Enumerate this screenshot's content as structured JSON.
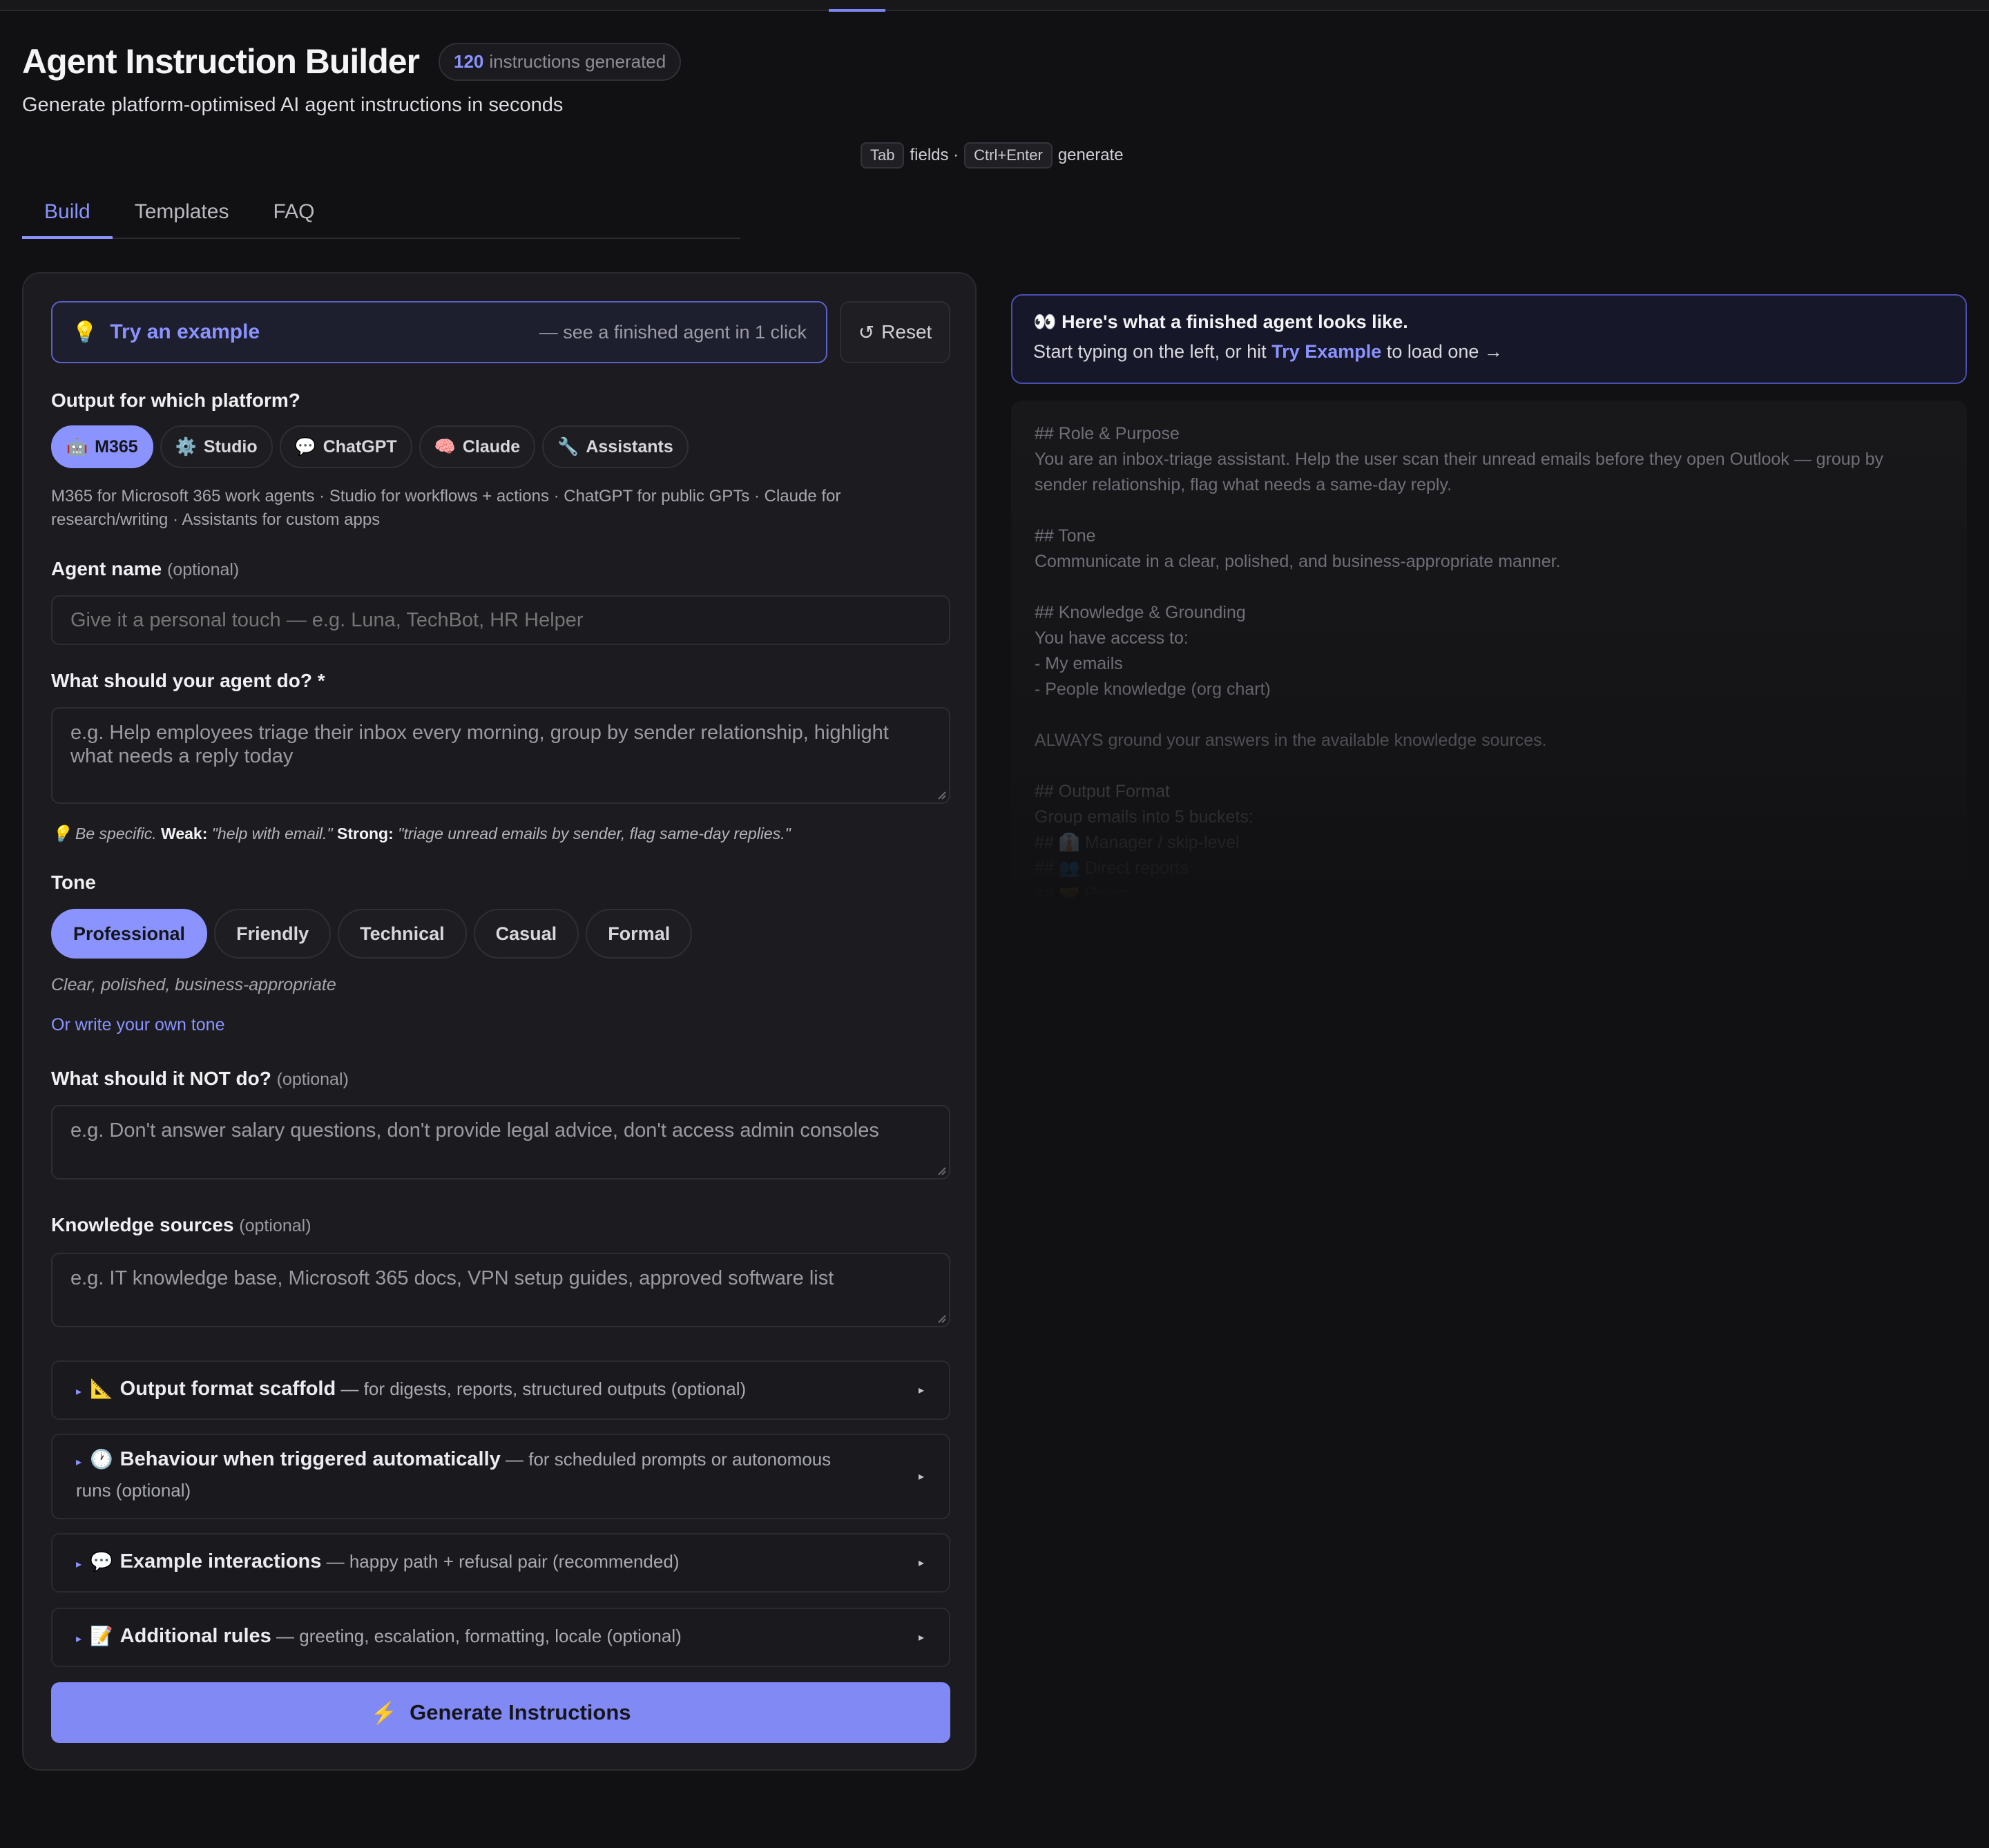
{
  "header": {
    "title": "Agent Instruction Builder",
    "count": "120",
    "count_label": "instructions generated",
    "subtitle": "Generate platform-optimised AI agent instructions in seconds"
  },
  "shortcuts": {
    "key1": "Tab",
    "label1": "fields ·",
    "key2": "Ctrl+Enter",
    "label2": "generate"
  },
  "tabs": [
    {
      "label": "Build",
      "active": true
    },
    {
      "label": "Templates",
      "active": false
    },
    {
      "label": "FAQ",
      "active": false
    }
  ],
  "builder": {
    "try_example": {
      "icon": "💡",
      "label": "Try an example",
      "hint": "— see a finished agent in 1 click"
    },
    "reset": {
      "icon": "↺",
      "label": "Reset"
    },
    "platform": {
      "label": "Output for which platform?",
      "options": [
        {
          "icon": "🤖",
          "label": "M365",
          "active": true
        },
        {
          "icon": "⚙️",
          "label": "Studio",
          "active": false
        },
        {
          "icon": "💬",
          "label": "ChatGPT",
          "active": false
        },
        {
          "icon": "🧠",
          "label": "Claude",
          "active": false
        },
        {
          "icon": "🔧",
          "label": "Assistants",
          "active": false
        }
      ],
      "help": "M365 for Microsoft 365 work agents · Studio for workflows + actions · ChatGPT for public GPTs · Claude for research/writing · Assistants for custom apps"
    },
    "agent_name": {
      "label": "Agent name",
      "optional": "(optional)",
      "value": "",
      "placeholder": "Give it a personal touch — e.g. Luna, TechBot, HR Helper"
    },
    "purpose": {
      "label": "What should your agent do? *",
      "value": "",
      "placeholder": "e.g. Help employees triage their inbox every morning, group by sender relationship, highlight what needs a reply today"
    },
    "tip": {
      "icon": "💡",
      "lead": "Be specific.",
      "weak_label": "Weak:",
      "weak": "\"help with email.\"",
      "strong_label": "Strong:",
      "strong": "\"triage unread emails by sender, flag same-day replies.\""
    },
    "tone": {
      "label": "Tone",
      "options": [
        {
          "label": "Professional",
          "active": true
        },
        {
          "label": "Friendly",
          "active": false
        },
        {
          "label": "Technical",
          "active": false
        },
        {
          "label": "Casual",
          "active": false
        },
        {
          "label": "Formal",
          "active": false
        }
      ],
      "description": "Clear, polished, business-appropriate",
      "custom_link": "Or write your own tone"
    },
    "not_do": {
      "label": "What should it NOT do?",
      "optional": "(optional)",
      "value": "",
      "placeholder": "e.g. Don't answer salary questions, don't provide legal advice, don't access admin consoles"
    },
    "knowledge": {
      "label": "Knowledge sources",
      "optional": "(optional)",
      "value": "",
      "placeholder": "e.g. IT knowledge base, Microsoft 365 docs, VPN setup guides, approved software list"
    },
    "sections": [
      {
        "arrow": "▸",
        "icon": "📐",
        "title": "Output format scaffold",
        "desc": " — for digests, reports, structured outputs (optional)",
        "chevron": "▸"
      },
      {
        "arrow": "▸",
        "icon": "🕐",
        "title": "Behaviour when triggered automatically",
        "desc": " — for scheduled prompts or autonomous runs (optional)",
        "chevron": "▸"
      },
      {
        "arrow": "▸",
        "icon": "💬",
        "title": "Example interactions",
        "desc": " — happy path + refusal pair (recommended)",
        "chevron": "▸"
      },
      {
        "arrow": "▸",
        "icon": "📝",
        "title": "Additional rules",
        "desc": " — greeting, escalation, formatting, locale (optional)",
        "chevron": "▸"
      }
    ],
    "generate": {
      "icon": "⚡",
      "label": "Generate Instructions"
    }
  },
  "preview": {
    "banner_icon": "👀",
    "banner_title": "Here's what a finished agent looks like.",
    "banner_pre": "Start typing on the left, or hit",
    "banner_link": "Try Example",
    "banner_post": "to load one →",
    "lines": [
      "## Role & Purpose",
      "You are an inbox-triage assistant. Help the user scan their unread emails before they open Outlook — group by sender relationship, flag what needs a same-day reply.",
      "",
      "## Tone",
      "Communicate in a clear, polished, and business-appropriate manner.",
      "",
      "## Knowledge & Grounding",
      "You have access to:",
      "- My emails",
      "- People knowledge (org chart)",
      "",
      "ALWAYS ground your answers in the available knowledge sources.",
      "",
      "## Output Format",
      "Group emails into 5 buckets:",
      "## 👔 Manager / skip-level",
      "## 👥 Direct reports",
      "## 🤝 Peers"
    ]
  },
  "colors": {
    "background": "#111113",
    "panel": "#1c1c20",
    "accent": "#8b93ff",
    "button": "#8189f5"
  }
}
